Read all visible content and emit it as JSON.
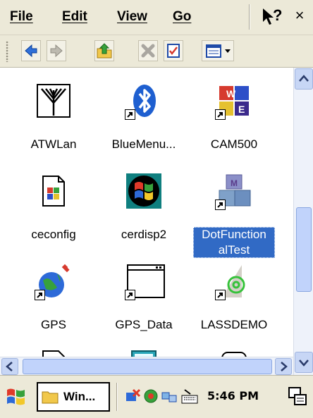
{
  "menubar": {
    "items": [
      "File",
      "Edit",
      "View",
      "Go"
    ],
    "help_label": "?",
    "close_label": "×"
  },
  "toolbar": {
    "buttons": [
      "back-icon",
      "forward-icon",
      "up-folder-icon",
      "delete-icon",
      "properties-icon",
      "view-icon"
    ]
  },
  "files": [
    {
      "name": "ATWLan",
      "icon": "antenna-icon",
      "shortcut": false,
      "selected": false
    },
    {
      "name": "BlueMenu...",
      "icon": "bluetooth-icon",
      "shortcut": true,
      "selected": false
    },
    {
      "name": "CAM500",
      "icon": "cam-blocks-icon",
      "shortcut": true,
      "selected": false
    },
    {
      "name": "ceconfig",
      "icon": "config-document-icon",
      "shortcut": false,
      "selected": false
    },
    {
      "name": "cerdisp2",
      "icon": "windows-flag-icon",
      "shortcut": false,
      "selected": false
    },
    {
      "name": "DotFunctionalTest",
      "label_lines": [
        "DotFunction",
        "alTest"
      ],
      "icon": "blocks-icon",
      "shortcut": true,
      "selected": true
    },
    {
      "name": "GPS",
      "icon": "globe-satellite-icon",
      "shortcut": true,
      "selected": false
    },
    {
      "name": "GPS_Data",
      "icon": "window-app-icon",
      "shortcut": true,
      "selected": false
    },
    {
      "name": "LASSDEMO",
      "icon": "green-at-icon",
      "shortcut": true,
      "selected": false
    }
  ],
  "taskbar": {
    "task_label": "Win...",
    "clock": "5:46 PM"
  },
  "colors": {
    "chrome": "#ece9d8",
    "selection": "#316ac5",
    "scrollbar": "#c1d3fb"
  }
}
